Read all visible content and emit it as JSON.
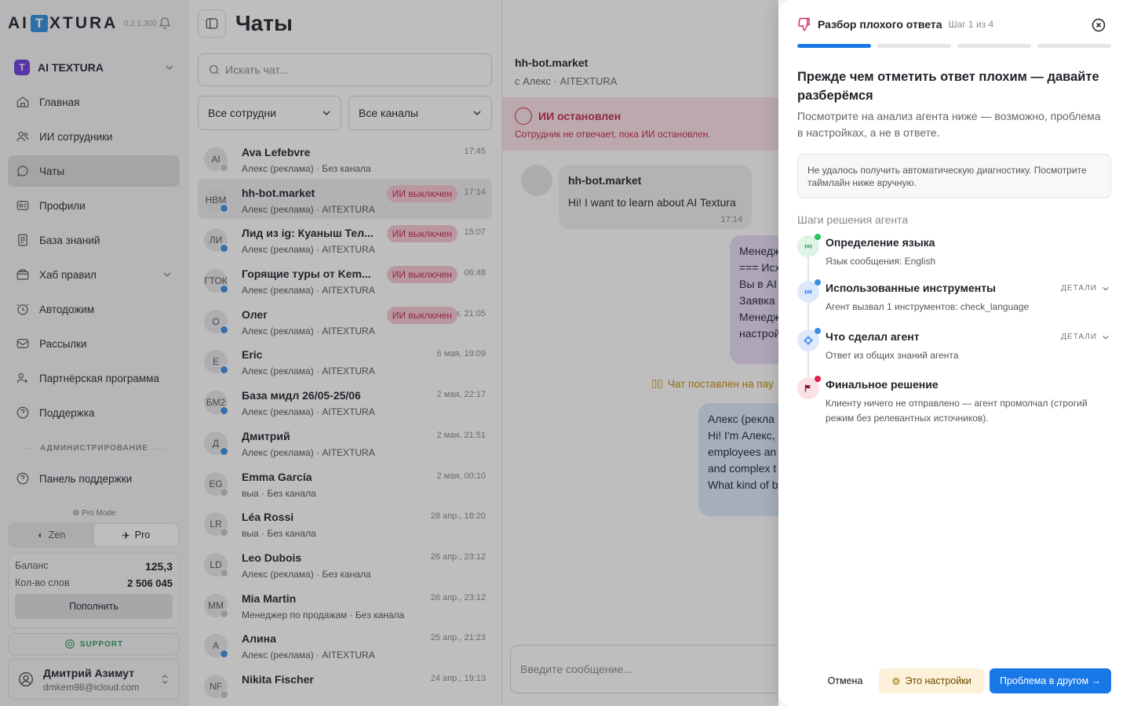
{
  "app": {
    "logo_left": "AI",
    "logo_t": "T",
    "logo_right": "XTURA",
    "version": "0.2.1.300"
  },
  "workspace": {
    "badge": "T",
    "name": "AI TEXTURA"
  },
  "nav": [
    {
      "label": "Главная",
      "icon": "home-icon"
    },
    {
      "label": "ИИ сотрудники",
      "icon": "users-icon"
    },
    {
      "label": "Чаты",
      "icon": "chat-icon",
      "active": true
    },
    {
      "label": "Профили",
      "icon": "profile-card-icon"
    },
    {
      "label": "База знаний",
      "icon": "document-icon"
    },
    {
      "label": "Хаб правил",
      "icon": "box-icon",
      "expandable": true
    },
    {
      "label": "Автодожим",
      "icon": "clock-icon"
    },
    {
      "label": "Рассылки",
      "icon": "mail-icon"
    },
    {
      "label": "Партнёрская программа",
      "icon": "partner-icon"
    },
    {
      "label": "Поддержка",
      "icon": "help-icon"
    }
  ],
  "admin": {
    "label": "АДМИНИСТРИРОВАНИЕ",
    "support_panel": "Панель поддержки"
  },
  "mode": {
    "label": "Pro Mode",
    "zen": "Zen",
    "pro": "Pro"
  },
  "balance": {
    "balance_label": "Баланс",
    "balance_value": "125,3",
    "words_label": "Кол-во слов",
    "words_value": "2 506 045",
    "topup": "Пополнить"
  },
  "support_btn": "SUPPORT",
  "user": {
    "name": "Дмитрий Азимут",
    "email": "dmkem98@icloud.com"
  },
  "chats": {
    "title": "Чаты",
    "search_placeholder": "Искать чат...",
    "filter_staff": "Все сотрудни",
    "filter_channels": "Все каналы",
    "items": [
      {
        "initials": "AI",
        "name": "Ava Lefebvre",
        "sub": "Алекс (реклама) · Без канала",
        "time": "17:45",
        "tag": "",
        "dot": "g"
      },
      {
        "initials": "HBM",
        "name": "hh-bot.market",
        "sub": "Алекс (реклама) · AITEXTURA",
        "time": "17:14",
        "tag": "ИИ выключен",
        "dot": "b",
        "selected": true
      },
      {
        "initials": "ЛИ",
        "name": "Лид из ig: Куаныш Тел...",
        "sub": "Алекс (реклама) · AITEXTURA",
        "time": "15:07",
        "tag": "ИИ выключен",
        "dot": "b"
      },
      {
        "initials": "ГТОК",
        "name": "Горящие туры от Kem...",
        "sub": "Алекс (реклама) · AITEXTURA",
        "time": "06:48",
        "tag": "ИИ выключен",
        "dot": "b"
      },
      {
        "initials": "О",
        "name": "Олег",
        "sub": "Алекс (реклама) · AITEXTURA",
        "time": "6 мая, 21:05",
        "tag": "ИИ выключен",
        "dot": "b"
      },
      {
        "initials": "E",
        "name": "Eric",
        "sub": "Алекс (реклама) · AITEXTURA",
        "time": "6 мая, 19:09",
        "tag": "",
        "dot": "b"
      },
      {
        "initials": "БМ2",
        "name": "База мидл 26/05-25/06",
        "sub": "Алекс (реклама) · AITEXTURA",
        "time": "2 мая, 22:17",
        "tag": "",
        "dot": "b"
      },
      {
        "initials": "Д",
        "name": "Дмитрий",
        "sub": "Алекс (реклама) · AITEXTURA",
        "time": "2 мая, 21:51",
        "tag": "",
        "dot": "b"
      },
      {
        "initials": "EG",
        "name": "Emma García",
        "sub": "выа · Без канала",
        "time": "2 мая, 00:10",
        "tag": "",
        "dot": "g"
      },
      {
        "initials": "LR",
        "name": "Léa Rossi",
        "sub": "выа · Без канала",
        "time": "28 апр., 18:20",
        "tag": "",
        "dot": "g"
      },
      {
        "initials": "LD",
        "name": "Leo Dubois",
        "sub": "Алекс (реклама) · Без канала",
        "time": "26 апр., 23:12",
        "tag": "",
        "dot": "g"
      },
      {
        "initials": "MM",
        "name": "Mia Martin",
        "sub": "Менеджер по продажам · Без канала",
        "time": "26 апр., 23:12",
        "tag": "",
        "dot": "g"
      },
      {
        "initials": "А",
        "name": "Алина",
        "sub": "Алекс (реклама) · AITEXTURA",
        "time": "25 апр., 21:23",
        "tag": "",
        "dot": "b"
      },
      {
        "initials": "NF",
        "name": "Nikita Fischer",
        "sub": "",
        "time": "24 апр., 19:13",
        "tag": "",
        "dot": "g"
      }
    ]
  },
  "conversation": {
    "name": "hh-bot.market",
    "sub": "с Алекс · AITEXTURA",
    "stopped_title": "ИИ остановлен",
    "stopped_desc": "Сотрудник не отвечает, пока ИИ остановлен.",
    "msg1_author": "hh-bot.market",
    "msg1_text": "Hi! I want to learn about AI Textura",
    "msg1_time": "17:14",
    "msg2_text": "Менедж\n=== Исх\nВы в AI\nЗаявка\nМенедж\nнастрой",
    "pause_text": "Чат поставлен на пау",
    "msg3_text": "Алекс (рекла\nHi! I'm Алекс,\nemployees an\nand complex t\nWhat kind of b",
    "input_placeholder": "Введите сообщение..."
  },
  "panel": {
    "title": "Разбор плохого ответа",
    "step": "Шаг 1 из 4",
    "progress": {
      "current": 1,
      "total": 4
    },
    "heading": "Прежде чем отметить ответ плохим — давайте разберёмся",
    "description": "Посмотрите на анализ агента ниже — возможно, проблема в настройках, а не в ответе.",
    "warning": "Не удалось получить автоматическую диагностику. Посмотрите таймлайн ниже вручную.",
    "steps_title": "Шаги решения агента",
    "steps": [
      {
        "title": "Определение языка",
        "desc": "Язык сообщения: English",
        "details": "",
        "icon": "radar-icon"
      },
      {
        "title": "Использованные инструменты",
        "desc": "Агент вызвал 1 инструментов: check_language",
        "details": "ДЕТАЛИ",
        "icon": "radar-icon"
      },
      {
        "title": "Что сделал агент",
        "desc": "Ответ из общих знаний агента",
        "details": "ДЕТАЛИ",
        "icon": "target-icon"
      },
      {
        "title": "Финальное решение",
        "desc": "Клиенту ничего не отправлено — агент промолчал (строгий режим без релевантных источников).",
        "details": "",
        "icon": "flag-icon"
      }
    ],
    "cancel": "Отмена",
    "settings_btn": "Это настройки",
    "other_btn": "Проблема в другом →"
  },
  "colors": {
    "accent": "#1878e8",
    "danger": "#c0264d",
    "green": "#2e9a5a",
    "purple": "#6d3bd8"
  }
}
